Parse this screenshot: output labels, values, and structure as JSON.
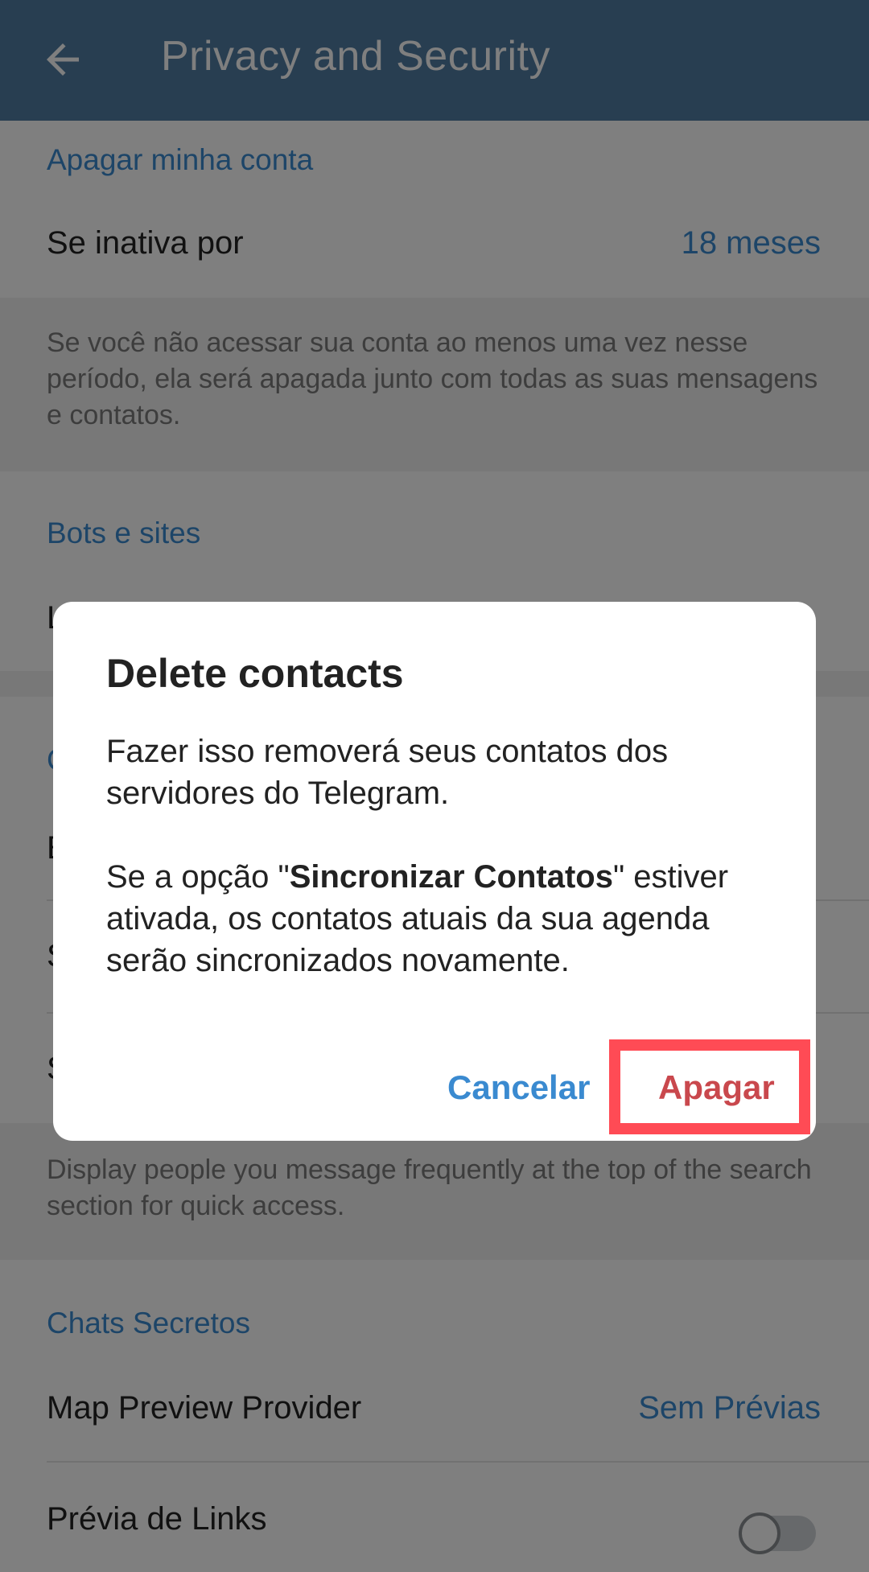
{
  "header": {
    "title": "Privacy and Security",
    "back_icon": "arrow-left-icon"
  },
  "sections": {
    "delete_account": {
      "heading": "Apagar minha conta",
      "row_label": "Se inativa por",
      "row_value": "18 meses",
      "hint": "Se você não acessar sua conta ao menos uma vez nesse período, ela será apagada junto com todas as suas mensagens e contatos."
    },
    "bots": {
      "heading": "Bots e sites",
      "row_label": "L"
    },
    "contacts": {
      "heading": "C",
      "row1_label": "E",
      "row2_label": "S",
      "row3_label": "S",
      "hint": "Display people you message frequently at the top of the search section for quick access."
    },
    "secret_chats": {
      "heading": "Chats Secretos",
      "map_label": "Map Preview Provider",
      "map_value": "Sem Prévias",
      "links_label": "Prévia de Links",
      "links_toggle_on": false
    }
  },
  "dialog": {
    "title": "Delete contacts",
    "body1": "Fazer isso removerá seus contatos dos servidores do Telegram.",
    "body2_pre": "Se a opção \"",
    "body2_bold": "Sincronizar Contatos",
    "body2_post": "\" estiver ativada, os contatos atuais da sua agenda serão sincronizados novamente.",
    "cancel_label": "Cancelar",
    "delete_label": "Apagar"
  },
  "colors": {
    "header": "#517da2",
    "accent": "#3a8ad0",
    "destructive": "#c9484d",
    "highlight": "#ff4b55"
  }
}
